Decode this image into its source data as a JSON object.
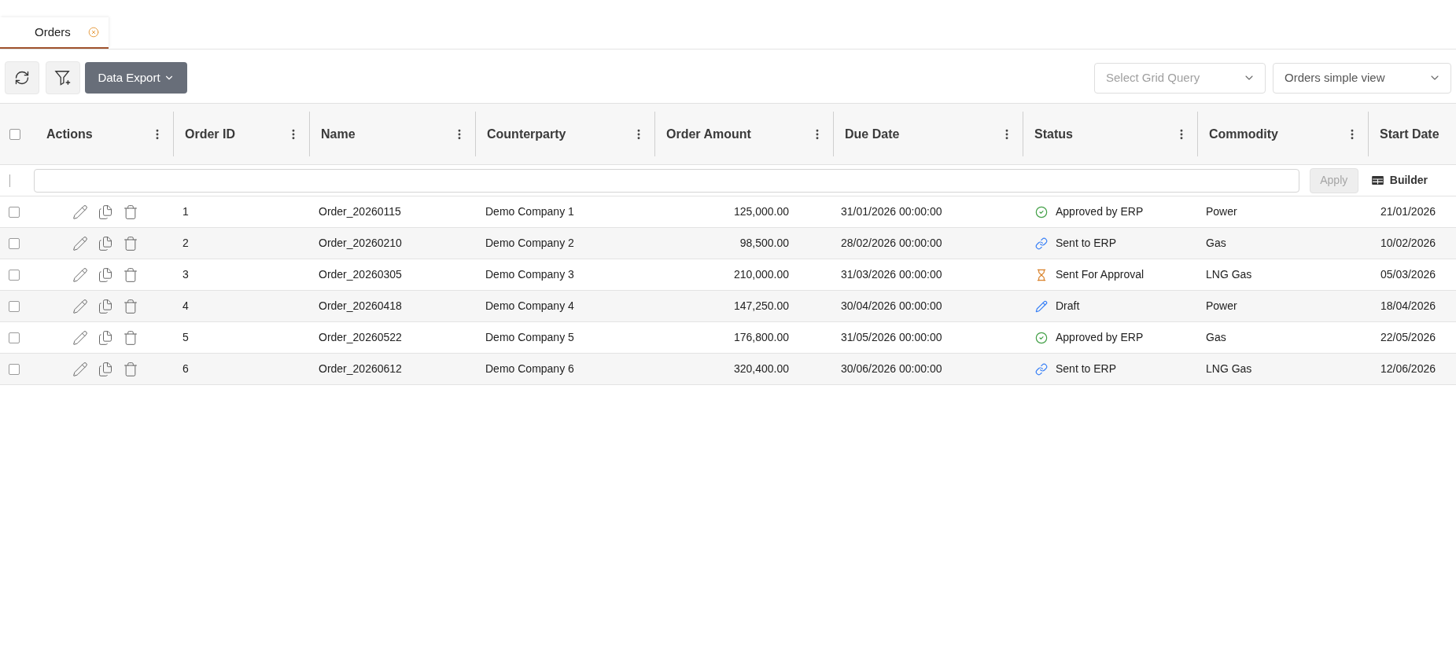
{
  "tabs": [
    {
      "label": "Orders",
      "selected": true,
      "closable": true
    }
  ],
  "toolbar": {
    "icon_buttons": [
      {
        "kind": "refresh"
      },
      {
        "kind": "add_filter"
      }
    ],
    "export_button": {
      "label": "Data Export"
    },
    "selects": [
      {
        "placeholder": "Select Grid Query"
      },
      {
        "value": "Orders simple view"
      }
    ]
  },
  "table": {
    "select_all": {
      "checked": false
    },
    "columns": [
      {
        "label": "Actions",
        "menu": true
      },
      {
        "label": "Order ID",
        "menu": true
      },
      {
        "label": "Name",
        "menu": true
      },
      {
        "label": "Counterparty",
        "menu": true
      },
      {
        "label": "Order Amount",
        "menu": true
      },
      {
        "label": "Due Date",
        "menu": true
      },
      {
        "label": "Status",
        "menu": true
      },
      {
        "label": "Commodity",
        "menu": true
      },
      {
        "label": "Start Date",
        "menu": false
      }
    ],
    "filter_row": {
      "apply_button": {
        "label": "Apply",
        "disabled": true
      },
      "builder_button": {
        "label": "Builder"
      }
    },
    "rows": [
      {
        "checked": false,
        "order_id": "1",
        "name": "Order_20260115",
        "counterparty": "Demo Company 1",
        "order_amount": "125,000.00",
        "due_date": "31/01/2026 00:00:00",
        "status": {
          "label": "Approved by ERP",
          "kind": "approved"
        },
        "commodity": "Power",
        "start_date": "21/01/2026"
      },
      {
        "checked": false,
        "order_id": "2",
        "name": "Order_20260210",
        "counterparty": "Demo Company 2",
        "order_amount": "98,500.00",
        "due_date": "28/02/2026 00:00:00",
        "status": {
          "label": "Sent to ERP",
          "kind": "sent"
        },
        "commodity": "Gas",
        "start_date": "10/02/2026"
      },
      {
        "checked": false,
        "order_id": "3",
        "name": "Order_20260305",
        "counterparty": "Demo Company 3",
        "order_amount": "210,000.00",
        "due_date": "31/03/2026 00:00:00",
        "status": {
          "label": "Sent For Approval",
          "kind": "pending"
        },
        "commodity": "LNG Gas",
        "start_date": "05/03/2026"
      },
      {
        "checked": false,
        "order_id": "4",
        "name": "Order_20260418",
        "counterparty": "Demo Company 4",
        "order_amount": "147,250.00",
        "due_date": "30/04/2026 00:00:00",
        "status": {
          "label": "Draft",
          "kind": "draft"
        },
        "commodity": "Power",
        "start_date": "18/04/2026"
      },
      {
        "checked": false,
        "order_id": "5",
        "name": "Order_20260522",
        "counterparty": "Demo Company 5",
        "order_amount": "176,800.00",
        "due_date": "31/05/2026 00:00:00",
        "status": {
          "label": "Approved by ERP",
          "kind": "approved"
        },
        "commodity": "Gas",
        "start_date": "22/05/2026"
      },
      {
        "checked": false,
        "order_id": "6",
        "name": "Order_20260612",
        "counterparty": "Demo Company 6",
        "order_amount": "320,400.00",
        "due_date": "30/06/2026 00:00:00",
        "status": {
          "label": "Sent to ERP",
          "kind": "sent"
        },
        "commodity": "LNG Gas",
        "start_date": "12/06/2026"
      }
    ]
  }
}
